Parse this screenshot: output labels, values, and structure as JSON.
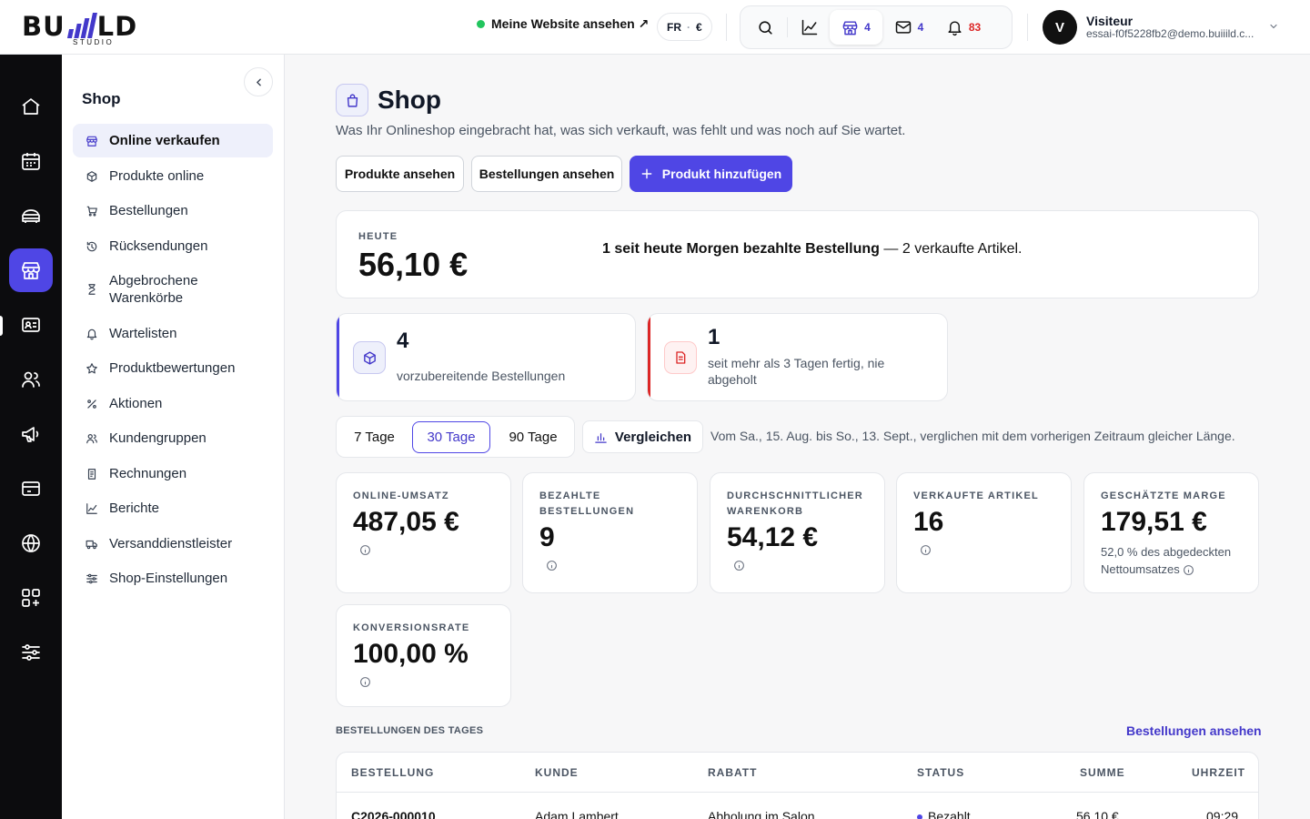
{
  "brand": {
    "logo_left": "BU",
    "logo_right": "LD",
    "logo_sub": "STUDIO",
    "accent": "#4f46e5"
  },
  "topbar": {
    "site_link": "Meine Website ansehen ↗",
    "lang": "FR",
    "lang_sep": "·",
    "currency": "€",
    "shop_count": "4",
    "mail_count": "4",
    "notif_count": "83",
    "user_initial": "V",
    "user_name": "Visiteur",
    "user_email": "essai-f0f5228fb2@demo.buiiild.c..."
  },
  "rail": {
    "items": [
      "home-icon",
      "calendar-icon",
      "services-icon",
      "shop-icon",
      "contact-card-icon",
      "people-icon",
      "megaphone-icon",
      "payment-card-icon",
      "globe-icon",
      "apps-icon",
      "settings-sliders-icon"
    ],
    "active": 3
  },
  "sidebar": {
    "title": "Shop",
    "items": [
      {
        "label": "Online verkaufen",
        "icon": "storefront-icon"
      },
      {
        "label": "Produkte online",
        "icon": "box-icon"
      },
      {
        "label": "Bestellungen",
        "icon": "cart-icon"
      },
      {
        "label": "Rücksendungen",
        "icon": "return-icon"
      },
      {
        "label": "Abgebrochene Warenkörbe",
        "icon": "hourglass-icon"
      },
      {
        "label": "Wartelisten",
        "icon": "bell-icon"
      },
      {
        "label": "Produktbewertungen",
        "icon": "star-icon"
      },
      {
        "label": "Aktionen",
        "icon": "percent-icon"
      },
      {
        "label": "Kundengruppen",
        "icon": "user-group-icon"
      },
      {
        "label": "Rechnungen",
        "icon": "invoice-icon"
      },
      {
        "label": "Berichte",
        "icon": "chart-icon"
      },
      {
        "label": "Versanddienstleister",
        "icon": "truck-icon"
      },
      {
        "label": "Shop-Einstellungen",
        "icon": "sliders-icon"
      }
    ]
  },
  "page": {
    "title": "Shop",
    "subtitle": "Was Ihr Onlineshop eingebracht hat, was sich verkauft, was fehlt und was noch auf Sie wartet.",
    "btn_products": "Produkte ansehen",
    "btn_orders": "Bestellungen ansehen",
    "btn_add": "Produkt hinzufügen"
  },
  "today": {
    "label": "HEUTE",
    "amount": "56,10 €",
    "summary_bold": "1 seit heute Morgen bezahlte Bestellung",
    "summary_rest": " — 2 verkaufte Artikel."
  },
  "alerts": [
    {
      "value": "4",
      "text": "vorzubereitende Bestellungen",
      "color": "#4f46e5"
    },
    {
      "value": "1",
      "text": "seit mehr als 3 Tagen fertig, nie abgeholt",
      "color": "#dc2626"
    }
  ],
  "periods": {
    "options": [
      "7 Tage",
      "30 Tage",
      "90 Tage"
    ],
    "selected": "30 Tage"
  },
  "compare_label": "Vergleichen",
  "range_text": "Vom Sa., 15. Aug. bis So., 13. Sept., verglichen mit dem vorherigen Zeitraum gleicher Länge.",
  "kpis": [
    {
      "label": "ONLINE-UMSATZ",
      "value": "487,05 €",
      "note": ""
    },
    {
      "label": "BEZAHLTE BESTELLUNGEN",
      "value": "9",
      "note": ""
    },
    {
      "label": "DURCHSCHNITTLICHER WARENKORB",
      "value": "54,12 €",
      "note": ""
    },
    {
      "label": "VERKAUFTE ARTIKEL",
      "value": "16",
      "note": ""
    },
    {
      "label": "GESCHÄTZTE MARGE",
      "value": "179,51 €",
      "note": "52,0 % des abgedeckten Nettoumsatzes"
    },
    {
      "label": "KONVERSIONSRATE",
      "value": "100,00 %",
      "note": ""
    }
  ],
  "orders": {
    "title": "BESTELLUNGEN DES TAGES",
    "link": "Bestellungen ansehen",
    "columns": [
      "BESTELLUNG",
      "KUNDE",
      "RABATT",
      "STATUS",
      "SUMME",
      "UHRZEIT"
    ],
    "rows": [
      [
        "C2026-000010",
        "Adam Lambert",
        "Abholung im Salon",
        "Bezahlt",
        "56,10 €",
        "09:29"
      ]
    ]
  }
}
